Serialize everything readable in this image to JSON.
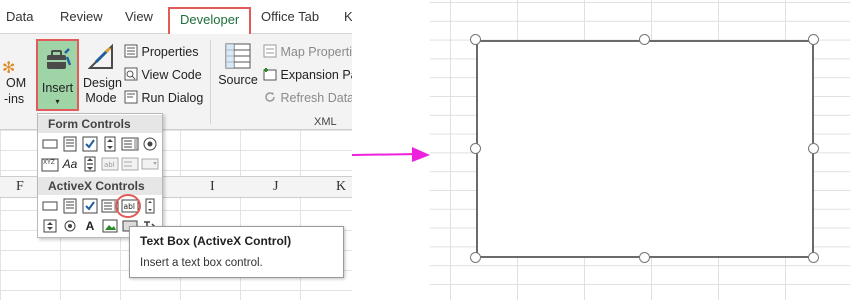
{
  "ribbon_tabs": [
    "Data",
    "Review",
    "View",
    "Developer",
    "Office Tab",
    "K"
  ],
  "ribbon": {
    "insert_label": "Insert",
    "insert_arrow": "▾",
    "design_mode_line1": "Design",
    "design_mode_line2": "Mode",
    "properties": "Properties",
    "view_code": "View Code",
    "run_dialog": "Run Dialog",
    "source": "Source",
    "map_properties": "Map Properties",
    "expansion_packs": "Expansion Pa",
    "refresh_data": "Refresh Data",
    "xml_group": "XML",
    "addins_partial_1": "OM",
    "addins_partial_2": "-ins"
  },
  "insert_menu": {
    "form_controls_header": "Form Controls",
    "activex_controls_header": "ActiveX Controls",
    "label_glyph": "Aa",
    "activex_label_glyph": "A",
    "textbox_glyph": "abl"
  },
  "sheet": {
    "columns": [
      "F",
      "I",
      "J",
      "K"
    ]
  },
  "tooltip": {
    "title": "Text Box (ActiveX Control)",
    "description": "Insert a text box control."
  },
  "colors": {
    "highlight_red": "#e25a5a",
    "insert_green": "#9fd4a6",
    "arrow_magenta": "#ee22dd",
    "developer_green": "#1e6e3a"
  }
}
